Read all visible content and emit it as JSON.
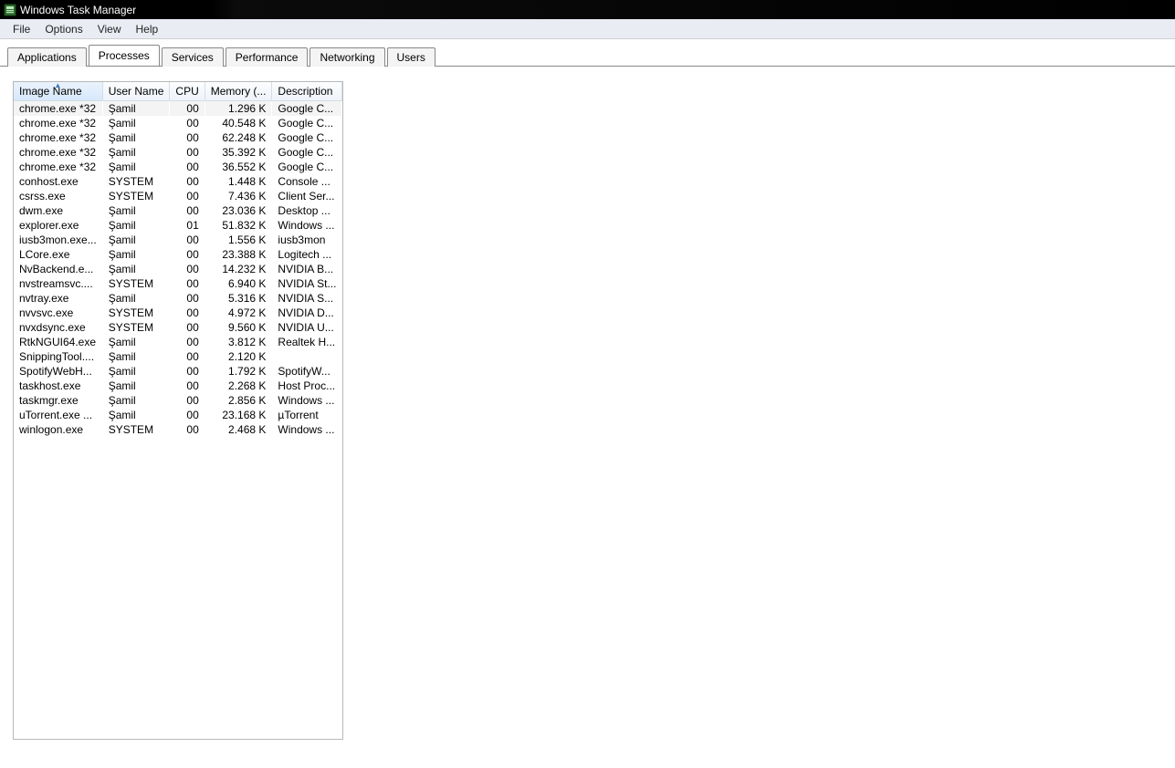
{
  "window": {
    "title": "Windows Task Manager"
  },
  "menu": {
    "items": [
      "File",
      "Options",
      "View",
      "Help"
    ]
  },
  "tabs": {
    "items": [
      "Applications",
      "Processes",
      "Services",
      "Performance",
      "Networking",
      "Users"
    ],
    "active": 1
  },
  "columns": [
    {
      "label": "Image Name",
      "key": "image",
      "sorted": true,
      "align": "left"
    },
    {
      "label": "User Name",
      "key": "user",
      "align": "left"
    },
    {
      "label": "CPU",
      "key": "cpu",
      "align": "right"
    },
    {
      "label": "Memory (...",
      "key": "mem",
      "align": "right"
    },
    {
      "label": "Description",
      "key": "desc",
      "align": "left"
    }
  ],
  "selected_row": 0,
  "processes": [
    {
      "image": "chrome.exe *32",
      "user": "Şamil",
      "cpu": "00",
      "mem": "1.296 K",
      "desc": "Google C..."
    },
    {
      "image": "chrome.exe *32",
      "user": "Şamil",
      "cpu": "00",
      "mem": "40.548 K",
      "desc": "Google C..."
    },
    {
      "image": "chrome.exe *32",
      "user": "Şamil",
      "cpu": "00",
      "mem": "62.248 K",
      "desc": "Google C..."
    },
    {
      "image": "chrome.exe *32",
      "user": "Şamil",
      "cpu": "00",
      "mem": "35.392 K",
      "desc": "Google C..."
    },
    {
      "image": "chrome.exe *32",
      "user": "Şamil",
      "cpu": "00",
      "mem": "36.552 K",
      "desc": "Google C..."
    },
    {
      "image": "conhost.exe",
      "user": "SYSTEM",
      "cpu": "00",
      "mem": "1.448 K",
      "desc": "Console ..."
    },
    {
      "image": "csrss.exe",
      "user": "SYSTEM",
      "cpu": "00",
      "mem": "7.436 K",
      "desc": "Client Ser..."
    },
    {
      "image": "dwm.exe",
      "user": "Şamil",
      "cpu": "00",
      "mem": "23.036 K",
      "desc": "Desktop ..."
    },
    {
      "image": "explorer.exe",
      "user": "Şamil",
      "cpu": "01",
      "mem": "51.832 K",
      "desc": "Windows ..."
    },
    {
      "image": "iusb3mon.exe...",
      "user": "Şamil",
      "cpu": "00",
      "mem": "1.556 K",
      "desc": "iusb3mon"
    },
    {
      "image": "LCore.exe",
      "user": "Şamil",
      "cpu": "00",
      "mem": "23.388 K",
      "desc": "Logitech ..."
    },
    {
      "image": "NvBackend.e...",
      "user": "Şamil",
      "cpu": "00",
      "mem": "14.232 K",
      "desc": "NVIDIA B..."
    },
    {
      "image": "nvstreamsvc....",
      "user": "SYSTEM",
      "cpu": "00",
      "mem": "6.940 K",
      "desc": "NVIDIA St..."
    },
    {
      "image": "nvtray.exe",
      "user": "Şamil",
      "cpu": "00",
      "mem": "5.316 K",
      "desc": "NVIDIA S..."
    },
    {
      "image": "nvvsvc.exe",
      "user": "SYSTEM",
      "cpu": "00",
      "mem": "4.972 K",
      "desc": "NVIDIA D..."
    },
    {
      "image": "nvxdsync.exe",
      "user": "SYSTEM",
      "cpu": "00",
      "mem": "9.560 K",
      "desc": "NVIDIA U..."
    },
    {
      "image": "RtkNGUI64.exe",
      "user": "Şamil",
      "cpu": "00",
      "mem": "3.812 K",
      "desc": "Realtek H..."
    },
    {
      "image": "SnippingTool....",
      "user": "Şamil",
      "cpu": "00",
      "mem": "2.120 K",
      "desc": ""
    },
    {
      "image": "SpotifyWebH...",
      "user": "Şamil",
      "cpu": "00",
      "mem": "1.792 K",
      "desc": "SpotifyW..."
    },
    {
      "image": "taskhost.exe",
      "user": "Şamil",
      "cpu": "00",
      "mem": "2.268 K",
      "desc": "Host Proc..."
    },
    {
      "image": "taskmgr.exe",
      "user": "Şamil",
      "cpu": "00",
      "mem": "2.856 K",
      "desc": "Windows ..."
    },
    {
      "image": "uTorrent.exe ...",
      "user": "Şamil",
      "cpu": "00",
      "mem": "23.168 K",
      "desc": "µTorrent"
    },
    {
      "image": "winlogon.exe",
      "user": "SYSTEM",
      "cpu": "00",
      "mem": "2.468 K",
      "desc": "Windows ..."
    }
  ]
}
